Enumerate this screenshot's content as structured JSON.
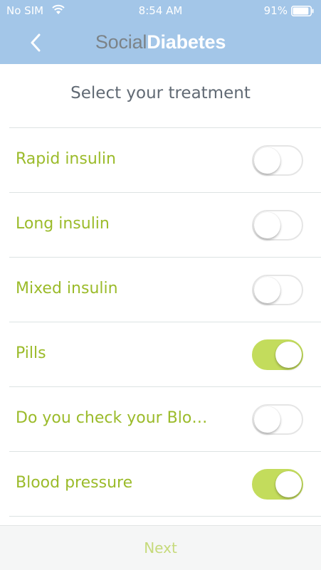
{
  "status_bar": {
    "carrier": "No SIM",
    "time": "8:54 AM",
    "battery_percent": "91%",
    "battery_level": 0.91,
    "wifi_icon": "wifi-icon"
  },
  "header": {
    "back_icon": "chevron-left-icon",
    "logo_part1": "Social",
    "logo_part2": "Diabetes",
    "bg_color": "#a3c6e8"
  },
  "heading": "Select your treatment",
  "treatments": [
    {
      "label": "Rapid insulin",
      "on": false
    },
    {
      "label": "Long insulin",
      "on": false
    },
    {
      "label": "Mixed insulin",
      "on": false
    },
    {
      "label": "Pills",
      "on": true
    },
    {
      "label": "Do you check your Blo…",
      "on": false
    },
    {
      "label": "Blood pressure",
      "on": true
    }
  ],
  "footer": {
    "next_label": "Next"
  },
  "colors": {
    "accent_green": "#9bbb2a",
    "toggle_on": "#c3dc5c",
    "heading_text": "#616a74"
  }
}
